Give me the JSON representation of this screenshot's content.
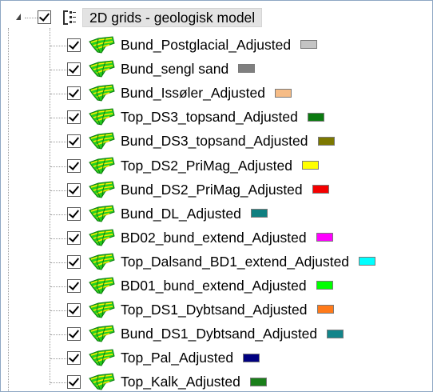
{
  "root": {
    "label": "2D grids - geologisk model",
    "checked": true,
    "expanded": true
  },
  "layers": [
    {
      "label": "Bund_Postglacial_Adjusted",
      "color": "#c4c4c4",
      "checked": true
    },
    {
      "label": "Bund_sengl sand",
      "color": "#7f7f7f",
      "checked": true
    },
    {
      "label": "Bund_Issøler_Adjusted",
      "color": "#f6bc86",
      "checked": true
    },
    {
      "label": "Top_DS3_topsand_Adjusted",
      "color": "#0b7a10",
      "checked": true
    },
    {
      "label": "Bund_DS3_topsand_Adjusted",
      "color": "#7c7800",
      "checked": true
    },
    {
      "label": "Top_DS2_PriMag_Adjusted",
      "color": "#ffff00",
      "checked": true
    },
    {
      "label": "Bund_DS2_PriMag_Adjusted",
      "color": "#f40000",
      "checked": true
    },
    {
      "label": "Bund_DL_Adjusted",
      "color": "#0f7f80",
      "checked": true
    },
    {
      "label": "BD02_bund_extend_Adjusted",
      "color": "#ff00ff",
      "checked": true
    },
    {
      "label": "Top_Dalsand_BD1_extend_Adjusted",
      "color": "#00ffff",
      "checked": true
    },
    {
      "label": "BD01_bund_extend_Adjusted",
      "color": "#00ff00",
      "checked": true
    },
    {
      "label": "Top_DS1_Dybtsand_Adjusted",
      "color": "#ff7a1a",
      "checked": true
    },
    {
      "label": "Bund_DS1_Dybtsand_Adjusted",
      "color": "#13858a",
      "checked": true
    },
    {
      "label": "Top_Pal_Adjusted",
      "color": "#000080",
      "checked": true
    },
    {
      "label": "Top_Kalk_Adjusted",
      "color": "#1a7f1a",
      "checked": true
    }
  ],
  "icons": {
    "expander": "triangle-down-icon",
    "group": "layer-group-icon",
    "layer": "grid-surface-icon"
  }
}
